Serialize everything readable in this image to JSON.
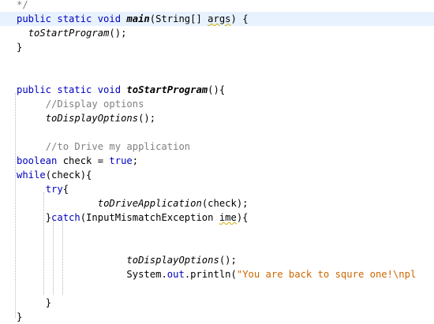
{
  "editor": {
    "language": "java",
    "colors": {
      "keyword": "#0000c0",
      "comment": "#808080",
      "string": "#cc6600",
      "field": "#0000c0",
      "current_line": "#e8f2fe"
    },
    "lines": [
      {
        "indent": "",
        "highlighted": false,
        "tokens": [
          {
            "t": "comment",
            "v": "*/"
          }
        ]
      },
      {
        "indent": "",
        "highlighted": true,
        "tokens": [
          {
            "t": "kw",
            "v": "public static void "
          },
          {
            "t": "method",
            "v": "main"
          },
          {
            "t": "text",
            "v": "(String[] "
          },
          {
            "t": "warn-y",
            "v": "args"
          },
          {
            "t": "text",
            "v": ") {"
          }
        ]
      },
      {
        "indent": "  ",
        "highlighted": false,
        "tokens": [
          {
            "t": "call",
            "v": "toStartProgram"
          },
          {
            "t": "text",
            "v": "();"
          }
        ]
      },
      {
        "indent": "",
        "highlighted": false,
        "tokens": [
          {
            "t": "text",
            "v": "}"
          }
        ]
      },
      {
        "indent": "",
        "highlighted": false,
        "tokens": []
      },
      {
        "indent": "",
        "highlighted": false,
        "tokens": []
      },
      {
        "indent": "",
        "highlighted": false,
        "tokens": [
          {
            "t": "kw",
            "v": "public static void "
          },
          {
            "t": "method",
            "v": "toStartProgram"
          },
          {
            "t": "text",
            "v": "(){"
          }
        ]
      },
      {
        "indent": "     ",
        "highlighted": false,
        "tokens": [
          {
            "t": "comment",
            "v": "//Display options"
          }
        ]
      },
      {
        "indent": "     ",
        "highlighted": false,
        "tokens": [
          {
            "t": "call",
            "v": "toDisplayOptions"
          },
          {
            "t": "text",
            "v": "();"
          }
        ]
      },
      {
        "indent": "",
        "highlighted": false,
        "tokens": []
      },
      {
        "indent": "     ",
        "highlighted": false,
        "tokens": [
          {
            "t": "comment",
            "v": "//to Drive my application"
          }
        ]
      },
      {
        "indent": "",
        "highlighted": false,
        "tokens": [
          {
            "t": "kw",
            "v": "boolean"
          },
          {
            "t": "text",
            "v": " check = "
          },
          {
            "t": "kw",
            "v": "true"
          },
          {
            "t": "text",
            "v": ";"
          }
        ]
      },
      {
        "indent": "",
        "highlighted": false,
        "tokens": [
          {
            "t": "kw",
            "v": "while"
          },
          {
            "t": "text",
            "v": "(check){"
          }
        ]
      },
      {
        "indent": "     ",
        "highlighted": false,
        "tokens": [
          {
            "t": "kw",
            "v": "try"
          },
          {
            "t": "text",
            "v": "{"
          }
        ]
      },
      {
        "indent": "              ",
        "highlighted": false,
        "tokens": [
          {
            "t": "call",
            "v": "toDriveApplication"
          },
          {
            "t": "text",
            "v": "(check);"
          }
        ]
      },
      {
        "indent": "     ",
        "highlighted": false,
        "tokens": [
          {
            "t": "text",
            "v": "}"
          },
          {
            "t": "kw",
            "v": "catch"
          },
          {
            "t": "text",
            "v": "(InputMismatchException "
          },
          {
            "t": "warn-y",
            "v": "ime"
          },
          {
            "t": "text",
            "v": "){"
          }
        ]
      },
      {
        "indent": "",
        "highlighted": false,
        "tokens": []
      },
      {
        "indent": "",
        "highlighted": false,
        "tokens": []
      },
      {
        "indent": "                   ",
        "highlighted": false,
        "tokens": [
          {
            "t": "call",
            "v": "toDisplayOptions"
          },
          {
            "t": "text",
            "v": "();"
          }
        ]
      },
      {
        "indent": "                   ",
        "highlighted": false,
        "tokens": [
          {
            "t": "text",
            "v": "System."
          },
          {
            "t": "field",
            "v": "out"
          },
          {
            "t": "text",
            "v": ".println("
          },
          {
            "t": "string",
            "v": "\"You are back to squre one!\\npl"
          }
        ]
      },
      {
        "indent": "",
        "highlighted": false,
        "tokens": []
      },
      {
        "indent": "     ",
        "highlighted": false,
        "tokens": [
          {
            "t": "text",
            "v": "}"
          }
        ]
      },
      {
        "indent": "",
        "highlighted": false,
        "tokens": [
          {
            "t": "text",
            "v": "}"
          }
        ]
      }
    ]
  }
}
